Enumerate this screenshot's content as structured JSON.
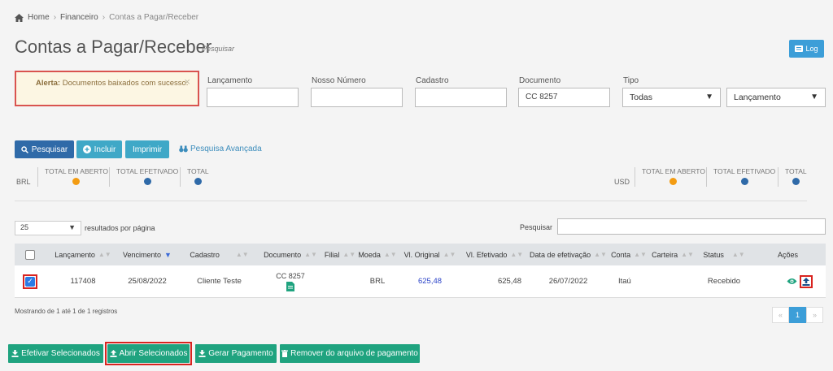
{
  "breadcrumb": {
    "home": "Home",
    "financeiro": "Financeiro",
    "current": "Contas a Pagar/Receber"
  },
  "header": {
    "title": "Contas a Pagar/Receber",
    "search_link": "Pesquisar",
    "log_label": "Log"
  },
  "alert": {
    "strong": "Alerta:",
    "message": "Documentos baixados com sucesso.",
    "close": "×"
  },
  "filters": {
    "lancamento": {
      "label": "Lançamento",
      "value": ""
    },
    "nosso_numero": {
      "label": "Nosso Número",
      "value": ""
    },
    "cadastro": {
      "label": "Cadastro",
      "value": ""
    },
    "documento": {
      "label": "Documento",
      "value": "CC 8257"
    },
    "tipo": {
      "label": "Tipo",
      "value": "Todas"
    },
    "data_tipo": {
      "value": "Lançamento"
    }
  },
  "actions": {
    "pesquisar": "Pesquisar",
    "incluir": "Incluir",
    "imprimir": "Imprimir",
    "pesquisa_avancada": "Pesquisa Avançada"
  },
  "totals": {
    "left": {
      "currency": "BRL",
      "aberto": "TOTAL EM ABERTO",
      "efetivado": "TOTAL EFETIVADO",
      "total": "TOTAL"
    },
    "right": {
      "currency": "USD",
      "aberto": "TOTAL EM ABERTO",
      "efetivado": "TOTAL EFETIVADO",
      "total": "TOTAL"
    }
  },
  "table_controls": {
    "per_page": "25",
    "per_page_label": "resultados por página",
    "search_label": "Pesquisar"
  },
  "table": {
    "headers": [
      "Lançamento",
      "Vencimento",
      "Cadastro",
      "Documento",
      "Filial",
      "Moeda",
      "Vl. Original",
      "Vl. Efetivado",
      "Data de efetivação",
      "Conta",
      "Carteira",
      "Status",
      "Ações"
    ],
    "row": {
      "checked": true,
      "lancamento": "117408",
      "vencimento": "25/08/2022",
      "cadastro": "Cliente Teste",
      "documento": "CC 8257",
      "filial": "",
      "moeda": "BRL",
      "vl_original": "625,48",
      "vl_efetivado": "625,48",
      "data_efetivacao": "26/07/2022",
      "conta": "Itaú",
      "carteira": "",
      "status": "Recebido"
    }
  },
  "footer": {
    "showing": "Mostrando de 1 até 1 de 1 registros",
    "page": "1",
    "prev": "«",
    "next": "»"
  },
  "bottom_buttons": {
    "efetivar": "Efetivar Selecionados",
    "abrir": "Abrir Selecionados",
    "gerar": "Gerar Pagamento",
    "remover": "Remover do arquivo de pagamento"
  },
  "colors": {
    "primary": "#2f6aa8",
    "info": "#3fa8c7",
    "success": "#1fa37f",
    "highlight": "#d9231f"
  }
}
